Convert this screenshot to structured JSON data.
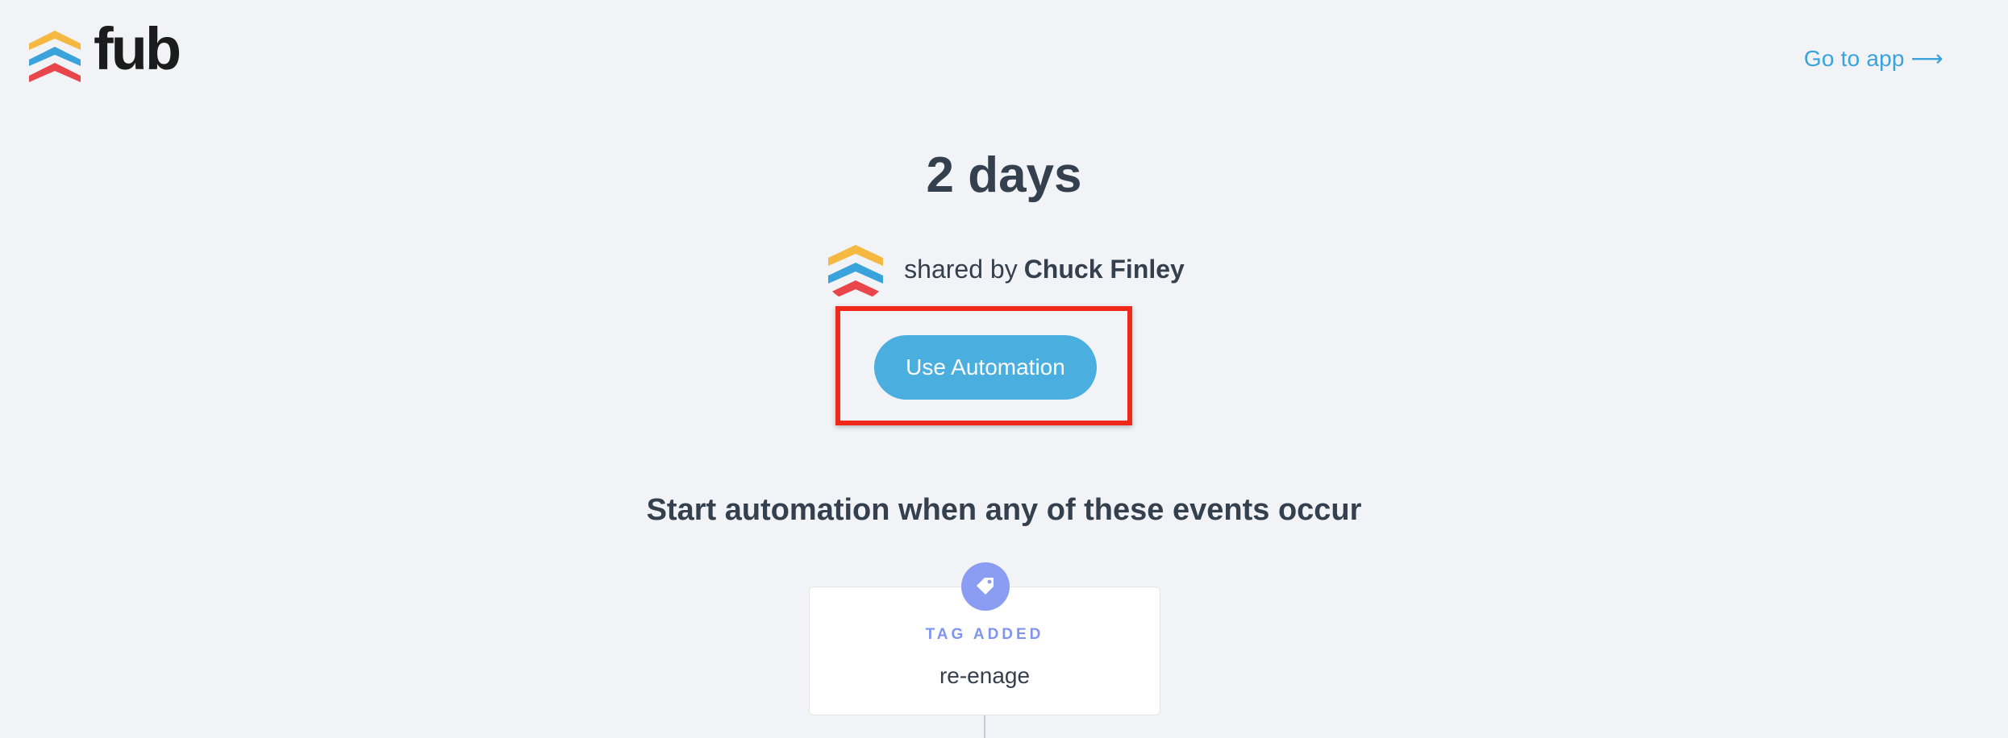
{
  "header": {
    "logo_text": "fub",
    "go_to_app_label": "Go to app ⟶"
  },
  "automation": {
    "title": "2 days",
    "shared_prefix": "shared by",
    "shared_by": "Chuck Finley",
    "use_button_label": "Use Automation"
  },
  "triggers": {
    "heading": "Start automation when any of these events occur",
    "items": [
      {
        "type": "TAG ADDED",
        "value": "re-enage",
        "icon": "tag-icon"
      }
    ]
  },
  "colors": {
    "page_bg": "#f2f3f6",
    "button": "#4aaedf",
    "link": "#3aa3dc",
    "highlight": "#f0281a",
    "trigger_accent": "#8b9cf3",
    "logo_yellow": "#f5b942",
    "logo_blue": "#3aa3dc",
    "logo_red": "#e8464b"
  }
}
